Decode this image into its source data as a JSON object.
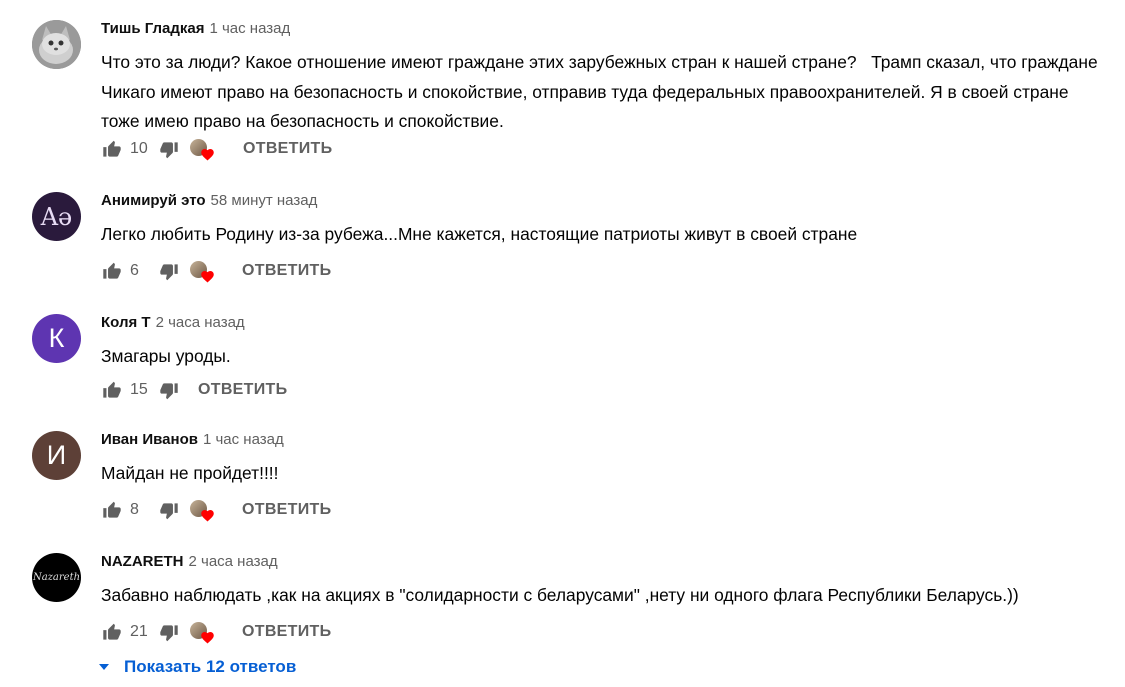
{
  "comments": [
    {
      "author": "Тишь Гладкая",
      "time": "1 час назад",
      "text": "Что это за люди? Какое отношение имеют граждане этих зарубежных стран к нашей стране?   Трамп сказал, что граждане Чикаго имеют право на безопасность и спокойствие, отправив туда федеральных правоохранителей. Я в своей стране тоже имею право на безопасность и спокойствие.",
      "likes": "10",
      "reply_label": "ОТВЕТИТЬ",
      "avatar_letter": "",
      "avatar_icon": "cat-photo-icon"
    },
    {
      "author": "Анимируй это",
      "time": "58 минут назад",
      "text": "Легко любить Родину из-за рубежа...Мне кажется, настоящие патриоты живут в своей стране",
      "likes": "6",
      "reply_label": "ОТВЕТИТЬ",
      "avatar_letter": "Aə",
      "avatar_color": "#2a1a3c"
    },
    {
      "author": "Коля Т",
      "time": "2 часа назад",
      "text": "Змагары уроды.",
      "likes": "15",
      "reply_label": "ОТВЕТИТЬ",
      "avatar_letter": "К",
      "avatar_color": "#5e35b1"
    },
    {
      "author": "Иван Иванов",
      "time": "1 час назад",
      "text": "Майдан не пройдет!!!!",
      "likes": "8",
      "reply_label": "ОТВЕТИТЬ",
      "avatar_letter": "И",
      "avatar_color": "#5d4037"
    },
    {
      "author": "NAZARETH",
      "time": "2 часа назад",
      "text": "Забавно наблюдать ,как на акциях в \"солидарности с беларусами\" ,нету ни одного флага Республики Беларусь.))",
      "likes": "21",
      "reply_label": "ОТВЕТИТЬ",
      "avatar_letter": "Nazareth",
      "avatar_color": "#000000"
    }
  ],
  "show_replies_label": "Показать 12 ответов",
  "colors": {
    "link": "#065fd4",
    "muted": "#606060",
    "heart": "#ff0000"
  }
}
